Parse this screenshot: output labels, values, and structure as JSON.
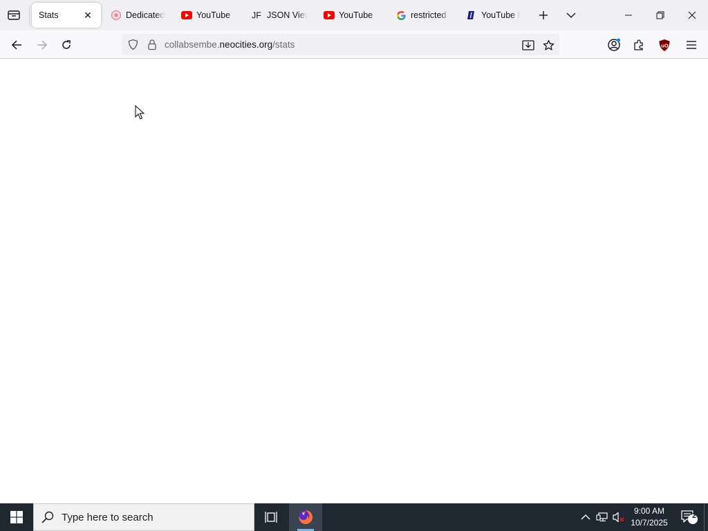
{
  "browser": {
    "tabs": [
      {
        "title": "Stats",
        "favicon": "none",
        "active": true
      },
      {
        "title": "Dedicated",
        "favicon": "dedicated-site-icon",
        "active": false
      },
      {
        "title": "YouTube",
        "favicon": "youtube-icon",
        "active": false
      },
      {
        "title": "JSON Viewer",
        "favicon": "json-viewer-icon",
        "active": false
      },
      {
        "title": "YouTube",
        "favicon": "youtube-icon",
        "active": false
      },
      {
        "title": "restricted m",
        "favicon": "google-icon",
        "active": false
      },
      {
        "title": "YouTube M",
        "favicon": "youtube-music-icon",
        "active": false
      }
    ],
    "close_glyph": "✕",
    "url": {
      "prefix": "collabsembe.",
      "domain": "neocities.org",
      "path": "/stats"
    }
  },
  "taskbar": {
    "search_placeholder": "Type here to search",
    "time": "9:00 AM",
    "date": "10/7/2025",
    "notification_count": "2"
  },
  "colors": {
    "youtube_red": "#ff0000",
    "firefox_orange": "#ff7139",
    "taskbar_bg": "#1f2731",
    "ublock_red": "#800000"
  }
}
